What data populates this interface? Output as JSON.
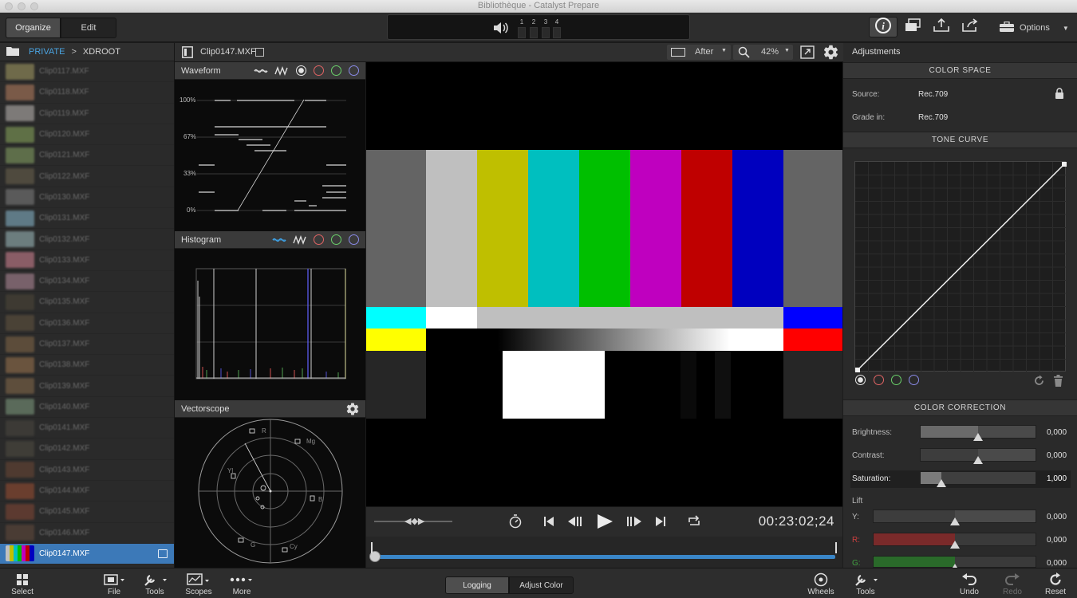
{
  "window": {
    "title": "Bibliothèque - Catalyst Prepare"
  },
  "toolbar": {
    "organize_label": "Organize",
    "edit_label": "Edit",
    "audio_channels": [
      "1",
      "2",
      "3",
      "4"
    ],
    "options_label": "Options"
  },
  "browser": {
    "breadcrumb": {
      "private": "PRIVATE",
      "separator": ">",
      "root": "XDROOT"
    },
    "clips": [
      {
        "name": "Clip0117.MXF",
        "thumb": "#6f6a4a"
      },
      {
        "name": "Clip0118.MXF",
        "thumb": "#7a5a48"
      },
      {
        "name": "Clip0119.MXF",
        "thumb": "#7d7a78"
      },
      {
        "name": "Clip0120.MXF",
        "thumb": "#5f7046"
      },
      {
        "name": "Clip0121.MXF",
        "thumb": "#5e6e4a"
      },
      {
        "name": "Clip0122.MXF",
        "thumb": "#4f4a3e"
      },
      {
        "name": "Clip0130.MXF",
        "thumb": "#5a5a5a"
      },
      {
        "name": "Clip0131.MXF",
        "thumb": "#5f7a86"
      },
      {
        "name": "Clip0132.MXF",
        "thumb": "#6c7d7e"
      },
      {
        "name": "Clip0133.MXF",
        "thumb": "#8a5d66"
      },
      {
        "name": "Clip0134.MXF",
        "thumb": "#78616a"
      },
      {
        "name": "Clip0135.MXF",
        "thumb": "#3e3a32"
      },
      {
        "name": "Clip0136.MXF",
        "thumb": "#4a4236"
      },
      {
        "name": "Clip0137.MXF",
        "thumb": "#5c4c3a"
      },
      {
        "name": "Clip0138.MXF",
        "thumb": "#6a543e"
      },
      {
        "name": "Clip0139.MXF",
        "thumb": "#5e4e3c"
      },
      {
        "name": "Clip0140.MXF",
        "thumb": "#5a6a5a"
      },
      {
        "name": "Clip0141.MXF",
        "thumb": "#3c3a36"
      },
      {
        "name": "Clip0142.MXF",
        "thumb": "#3f3d37"
      },
      {
        "name": "Clip0143.MXF",
        "thumb": "#4f3a30"
      },
      {
        "name": "Clip0144.MXF",
        "thumb": "#6a3e2e"
      },
      {
        "name": "Clip0145.MXF",
        "thumb": "#5c3a30"
      },
      {
        "name": "Clip0146.MXF",
        "thumb": "#4a3c34"
      }
    ],
    "selected_clip": "Clip0147.MXF"
  },
  "clip_header": {
    "title": "Clip0147.MXF",
    "view_mode": "After",
    "zoom": "42%"
  },
  "scopes": {
    "waveform": {
      "title": "Waveform",
      "ticks": [
        "100%",
        "67%",
        "33%",
        "0%"
      ]
    },
    "histogram": {
      "title": "Histogram"
    },
    "vectorscope": {
      "title": "Vectorscope",
      "targets": [
        "R",
        "Mg",
        "Yl",
        "B",
        "G",
        "Cy"
      ]
    }
  },
  "viewer": {
    "bars_top": [
      "#646464",
      "#bfbfbf",
      "#bfbf00",
      "#00bfbf",
      "#00bf00",
      "#bf00bf",
      "#bf0000",
      "#0000bf",
      "#646464"
    ],
    "timecode": "00:23:02;24",
    "playhead": 0
  },
  "adjustments": {
    "panel_title": "Adjustments",
    "color_space": {
      "title": "COLOR SPACE",
      "source_label": "Source:",
      "source_value": "Rec.709",
      "grade_label": "Grade in:",
      "grade_value": "Rec.709"
    },
    "tone_curve": {
      "title": "TONE CURVE"
    },
    "color_correction": {
      "title": "COLOR CORRECTION",
      "brightness": {
        "label": "Brightness:",
        "value": "0,000",
        "level": 0.5
      },
      "contrast": {
        "label": "Contrast:",
        "value": "0,000",
        "level": 0.5
      },
      "saturation": {
        "label": "Saturation:",
        "value": "1,000",
        "level": 0.18
      },
      "lift_title": "Lift",
      "lift_y": {
        "label": "Y:",
        "value": "0,000",
        "level": 0.5
      },
      "lift_r": {
        "label": "R:",
        "value": "0,000",
        "level": 0.5
      },
      "lift_g": {
        "label": "G:",
        "value": "0,000",
        "level": 0.5
      }
    }
  },
  "bottombar": {
    "select": "Select",
    "file": "File",
    "tools": "Tools",
    "scopes": "Scopes",
    "more": "More",
    "logging": "Logging",
    "adjust_color": "Adjust Color",
    "wheels": "Wheels",
    "tools_right": "Tools",
    "undo": "Undo",
    "redo": "Redo",
    "reset": "Reset"
  }
}
